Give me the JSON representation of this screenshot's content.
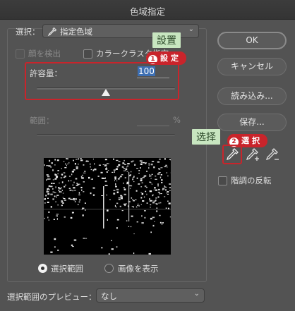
{
  "window": {
    "title": "色域指定"
  },
  "select": {
    "label": "選択：",
    "value": "指定色域"
  },
  "options": {
    "detect_faces": "顔を検出",
    "color_clusters": "カラークラスタ指定"
  },
  "fuzziness": {
    "label": "許容量：",
    "value": "100",
    "level_percent": 50
  },
  "range": {
    "label": "範囲：",
    "value": "",
    "unit": "%"
  },
  "buttons": {
    "ok": "OK",
    "cancel": "キャンセル",
    "load": "読み込み...",
    "save": "保存..."
  },
  "invert": {
    "label": "階調の反転"
  },
  "view_mode": {
    "selection": "選択範囲",
    "image": "画像を表示",
    "selected": "selection"
  },
  "selection_preview": {
    "label": "選択範囲のプレビュー：",
    "value": "なし"
  },
  "annotations": {
    "setting_label": "設置",
    "step1_num": "1",
    "step1_text": "設定",
    "select_label": "选择",
    "step2_num": "2",
    "step2_text": "選択"
  },
  "colors": {
    "annotation_red": "#c9242b",
    "annotation_green": "#c8e6c0"
  }
}
